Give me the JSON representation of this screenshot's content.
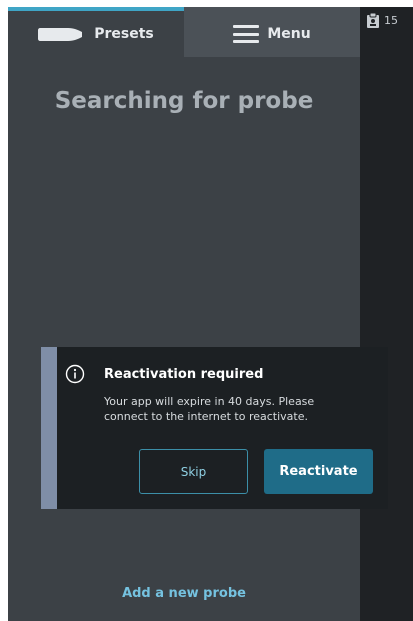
{
  "tabs": {
    "presets_label": "Presets",
    "menu_label": "Menu"
  },
  "status": {
    "count": "15"
  },
  "main": {
    "title": "Searching for probe",
    "add_probe_link": "Add a new probe"
  },
  "dialog": {
    "title": "Reactivation required",
    "body": "Your app will expire in 40 days. Please connect to the internet to reactivate.",
    "skip_label": "Skip",
    "reactivate_label": "Reactivate"
  },
  "colors": {
    "background": "#3c4146",
    "tab_inactive": "#4b5157",
    "accent": "#3fa5c6",
    "dialog_bg": "#1c2023",
    "dialog_accent_bar": "#7f8ea7",
    "primary_button": "#1f6c88",
    "link": "#75c2e0"
  },
  "icons": {
    "probe": "probe-icon",
    "menu": "hamburger-icon",
    "info": "info-icon",
    "clipboard": "clipboard-icon"
  }
}
